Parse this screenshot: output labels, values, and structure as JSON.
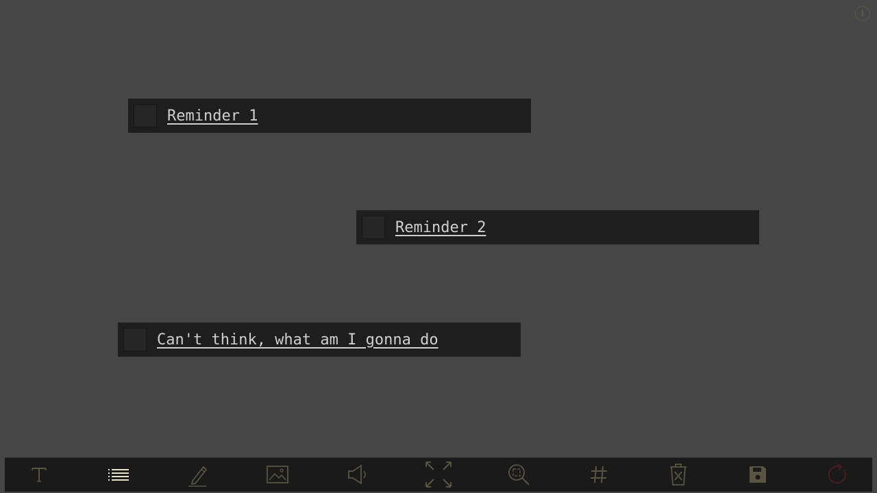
{
  "colors": {
    "background": "#464646",
    "note_background": "#1e1e1e",
    "note_text": "#cfcfcf",
    "toolbar_background": "#1a1a1a",
    "icon_dim": "#5a5542",
    "icon_active": "#e8e2c0",
    "refresh_icon": "#4a1e1e"
  },
  "info": {
    "glyph": "i",
    "icon": "info-icon"
  },
  "notes": [
    {
      "text": "Reminder 1",
      "checked": false
    },
    {
      "text": "Reminder 2",
      "checked": false
    },
    {
      "text": "Can't think, what am I gonna do",
      "checked": false
    }
  ],
  "toolbar": {
    "tools": [
      {
        "name": "text",
        "icon": "text-icon",
        "active": false
      },
      {
        "name": "list",
        "icon": "list-icon",
        "active": true
      },
      {
        "name": "draw",
        "icon": "pencil-icon",
        "active": false
      },
      {
        "name": "image",
        "icon": "image-icon",
        "active": false
      },
      {
        "name": "audio",
        "icon": "speaker-icon",
        "active": false
      },
      {
        "name": "fullscreen",
        "icon": "expand-icon",
        "active": false
      },
      {
        "name": "zoom",
        "icon": "zoom-icon",
        "active": false
      },
      {
        "name": "grid",
        "icon": "hash-icon",
        "active": false
      },
      {
        "name": "delete",
        "icon": "trash-icon",
        "active": false
      },
      {
        "name": "save",
        "icon": "save-icon",
        "active": false
      },
      {
        "name": "reset",
        "icon": "refresh-icon",
        "active": false
      }
    ]
  }
}
